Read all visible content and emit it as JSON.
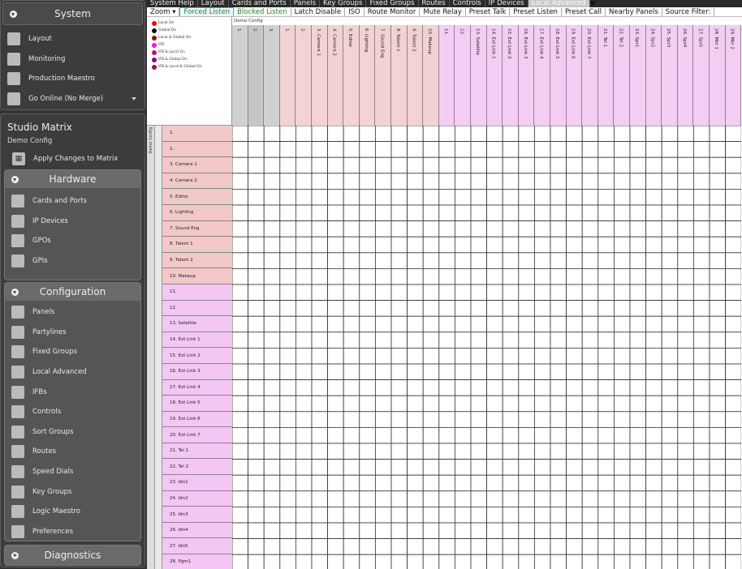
{
  "sidebar": {
    "system_title": "System",
    "system_items": [
      {
        "label": "Layout",
        "icon": "layout-icon"
      },
      {
        "label": "Monitoring",
        "icon": "monitoring-icon"
      },
      {
        "label": "Production Maestro",
        "icon": "production-maestro-icon"
      },
      {
        "label": "Go Online (No Merge)",
        "icon": "go-online-icon"
      }
    ],
    "studio_title": "Studio Matrix",
    "studio_subtitle": "Demo Config",
    "apply_label": "Apply Changes to Matrix",
    "hardware_title": "Hardware",
    "hardware_items": [
      {
        "label": "Cards and Ports",
        "icon": "cards-ports-icon"
      },
      {
        "label": "IP Devices",
        "icon": "ip-devices-icon"
      },
      {
        "label": "GPOs",
        "icon": "gpos-icon"
      },
      {
        "label": "GPIs",
        "icon": "gpis-icon"
      }
    ],
    "configuration_title": "Configuration",
    "configuration_items": [
      {
        "label": "Panels",
        "icon": "panels-icon"
      },
      {
        "label": "Partylines",
        "icon": "partylines-icon"
      },
      {
        "label": "Fixed Groups",
        "icon": "fixed-groups-icon"
      },
      {
        "label": "Local Advanced",
        "icon": "local-advanced-icon"
      },
      {
        "label": "IFBs",
        "icon": "ifbs-icon"
      },
      {
        "label": "Controls",
        "icon": "controls-icon"
      },
      {
        "label": "Sort Groups",
        "icon": "sort-groups-icon"
      },
      {
        "label": "Routes",
        "icon": "routes-icon"
      },
      {
        "label": "Speed Dials",
        "icon": "speed-dials-icon"
      },
      {
        "label": "Key Groups",
        "icon": "key-groups-icon"
      },
      {
        "label": "Logic Maestro",
        "icon": "logic-maestro-icon"
      },
      {
        "label": "Preferences",
        "icon": "preferences-icon"
      }
    ],
    "diagnostics_title": "Diagnostics"
  },
  "tabs": [
    "System Help",
    "Layout",
    "Cards and Ports",
    "Panels",
    "Key Groups",
    "Fixed Groups",
    "Routes",
    "Controls",
    "IP Devices",
    "Local Advanced"
  ],
  "active_tab": "Local Advanced",
  "toolbar": {
    "zoom": "Zoom ▾",
    "items": [
      "Forced Listen",
      "Blocked Listen",
      "Latch Disable",
      "ISO",
      "Route Monitor",
      "Mute Relay",
      "Preset Talk",
      "Preset Listen",
      "Preset Call",
      "Nearby Panels",
      "Source Filter:"
    ]
  },
  "legend": [
    {
      "label": "Local On",
      "color": "#e01010"
    },
    {
      "label": "Global On",
      "color": "#111111"
    },
    {
      "label": "Local & Global On",
      "color": "#8a1010"
    },
    {
      "label": "IFB",
      "color": "#e020e0"
    },
    {
      "label": "IFB & Local On",
      "color": "#c01070"
    },
    {
      "label": "IFB & Global On",
      "color": "#7a1080"
    },
    {
      "label": "IFB & Local & Global On",
      "color": "#901050"
    }
  ],
  "grid": {
    "config_label": "Demo Config",
    "row_group_label": "Demo Config",
    "columns": [
      "1.",
      "2.",
      "3.",
      "1.",
      "2.",
      "3. Camera 1",
      "4. Camera 2",
      "5. Editor",
      "6. Lighting",
      "7. Sound Eng",
      "8. Talent 1",
      "9. Talent 2",
      "10. Makeup",
      "11.",
      "12.",
      "13. Satellite",
      "14. Ext Link 1",
      "15. Ext Link 2",
      "16. Ext Link 3",
      "17. Ext Link 4",
      "18. Ext Link 5",
      "19. Ext Link 6",
      "20. Ext Link 7",
      "21. Tel 1",
      "22. Tel 2",
      "23. Spr1",
      "24. Spr2",
      "25. Spr3",
      "26. Spr4",
      "27. Spr5",
      "28. Mkr 1",
      "29. Mkr 2"
    ],
    "col_colors": [
      "#d0d0d0",
      "#c6c6c6",
      "#d0d0d0",
      "#f2d2d2",
      "#f2d2d2",
      "#f2d2d2",
      "#f2d2d2",
      "#f2d2d2",
      "#f2d2d2",
      "#f2d2d2",
      "#f2d2d2",
      "#f2d2d2",
      "#f2d2d2",
      "#f3cdf3",
      "#f3cdf3",
      "#f3cdf3",
      "#f3cdf3",
      "#f3cdf3",
      "#f3cdf3",
      "#f3cdf3",
      "#f3cdf3",
      "#f3cdf3",
      "#f3cdf3",
      "#f3cdf3",
      "#f3cdf3",
      "#f3cdf3",
      "#f3cdf3",
      "#f3cdf3",
      "#f3cdf3",
      "#f3cdf3",
      "#f3cdf3",
      "#f3cdf3"
    ],
    "rows": [
      "1.",
      "2.",
      "3. Camera 1",
      "4. Camera 2",
      "5. Editor",
      "6. Lighting",
      "7. Sound Eng",
      "8. Talent 1",
      "9. Talent 2",
      "10. Makeup",
      "11.",
      "12.",
      "13. Satellite",
      "14. Ext Link 1",
      "15. Ext Link 2",
      "16. Ext Link 3",
      "17. Ext Link 4",
      "18. Ext Link 5",
      "19. Ext Link 6",
      "20. Ext Link 7",
      "21. Tel 1",
      "22. Tel 2",
      "23. Idn1",
      "24. Idn2",
      "25. Idn3",
      "26. Idn4",
      "27. Idn5",
      "28. Pgm1"
    ],
    "row_colors": [
      "#f2c8c8",
      "#f2c8c8",
      "#f2c8c8",
      "#f2c8c8",
      "#f2c8c8",
      "#f2c8c8",
      "#f2c8c8",
      "#f2c8c8",
      "#f2c8c8",
      "#f2c8c8",
      "#f3c6f3",
      "#f3c6f3",
      "#f3c6f3",
      "#f3c6f3",
      "#f3c6f3",
      "#f3c6f3",
      "#f3c6f3",
      "#f3c6f3",
      "#f3c6f3",
      "#f3c6f3",
      "#f3c6f3",
      "#f3c6f3",
      "#f3c6f3",
      "#f3c6f3",
      "#f3c6f3",
      "#f3c6f3",
      "#f3c6f3",
      "#f3c6f3"
    ]
  }
}
